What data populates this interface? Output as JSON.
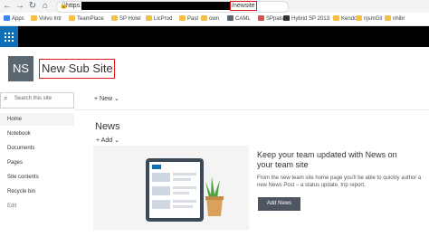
{
  "browser": {
    "url_prefix": "https://",
    "url_suffix": "/newsite"
  },
  "bookmarks": [
    {
      "label": "Apps",
      "color": "#4285f4"
    },
    {
      "label": "Volvo Intr",
      "color": "#f4c04a"
    },
    {
      "label": "TeamPlace",
      "color": "#f4c04a"
    },
    {
      "label": "SP Hotel",
      "color": "#f4c04a"
    },
    {
      "label": "LicProd",
      "color": "#f4c04a"
    },
    {
      "label": "Past",
      "color": "#f4c04a"
    },
    {
      "label": "own",
      "color": "#f4c04a"
    },
    {
      "label": "CAML",
      "color": "#5b6770"
    },
    {
      "label": "SPpals",
      "color": "#d9534f"
    },
    {
      "label": "Hybrid SP 2013",
      "color": "#333333"
    },
    {
      "label": "Kendo",
      "color": "#f4c04a"
    },
    {
      "label": "njsmGit",
      "color": "#f4c04a"
    },
    {
      "label": "nhibr",
      "color": "#f4c04a"
    }
  ],
  "site": {
    "logo_initials": "NS",
    "title": "New Sub Site"
  },
  "left_nav": {
    "search_placeholder": "Search this site",
    "items": [
      "Home",
      "Notebook",
      "Documents",
      "Pages",
      "Site contents",
      "Recycle bin",
      "Edit"
    ]
  },
  "command_bar": {
    "new_label": "New"
  },
  "news": {
    "title": "News",
    "add_label": "Add",
    "heading": "Keep your team updated with News on your team site",
    "body": "From the new team site home page you'll be able to quickly author a new News Post – a status update, trip report,",
    "add_news_button": "Add News"
  },
  "colors": {
    "suite_bar": "#000000",
    "waffle": "#0e6eb8",
    "highlight": "#e0191b",
    "logo_bg": "#5b6770",
    "button_bg": "#4d5660"
  }
}
